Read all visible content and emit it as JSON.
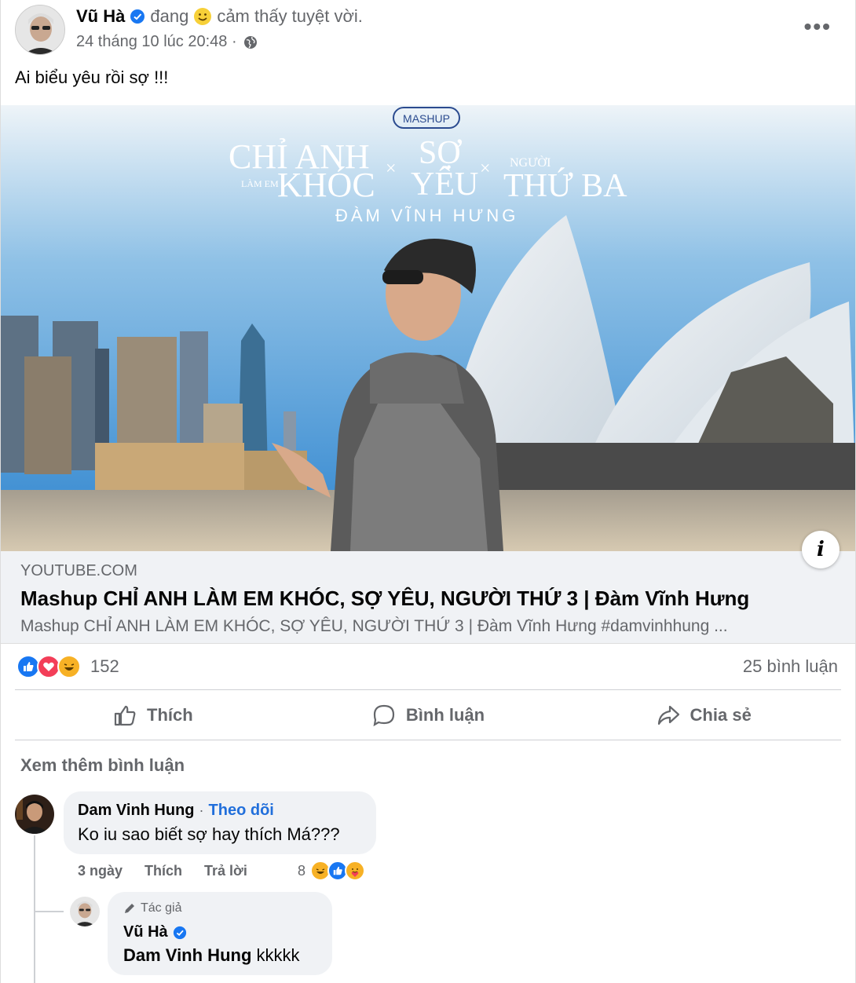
{
  "post": {
    "author": "Vũ Hà",
    "feeling_prefix": "đang",
    "feeling_text": "cảm thấy tuyệt vời.",
    "timestamp": "24 tháng 10 lúc 20:48 ·",
    "more_label": "•••",
    "text": "Ai biểu yêu rồi sợ !!!"
  },
  "media": {
    "badge": "MASHUP",
    "title_part1_big": "CHỈ ANH",
    "title_part1_small": "LÀM EM",
    "title_part1_end": "KHÓC",
    "title_part2_line1": "SỢ",
    "title_part2_line2": "YÊU",
    "title_part3_small": "NGƯỜI",
    "title_part3_big": "THỨ BA",
    "separator": "×",
    "artist": "ĐÀM VĨNH HƯNG"
  },
  "link": {
    "domain": "YOUTUBE.COM",
    "title": "Mashup CHỈ ANH LÀM EM KHÓC, SỢ YÊU, NGƯỜI THỨ 3 | Đàm Vĩnh Hưng",
    "description": "Mashup CHỈ ANH LÀM EM KHÓC, SỢ YÊU, NGƯỜI THỨ 3 | Đàm Vĩnh Hưng #damvinhhung ...",
    "info_label": "i"
  },
  "stats": {
    "reaction_count": "152",
    "comment_count": "25 bình luận"
  },
  "actions": {
    "like": "Thích",
    "comment": "Bình luận",
    "share": "Chia sẻ"
  },
  "comments_section": {
    "see_more": "Xem thêm bình luận",
    "comment1": {
      "name": "Dam Vinh Hung",
      "dot": "·",
      "follow": "Theo dõi",
      "text": "Ko iu sao biết sợ hay thích Má???",
      "time": "3 ngày",
      "like": "Thích",
      "reply": "Trả lời",
      "reaction_count": "8"
    },
    "reply1": {
      "badge": "Tác giả",
      "name": "Vũ Hà",
      "mention": "Dam Vinh Hung",
      "text": " kkkkk"
    }
  },
  "colors": {
    "facebook_blue": "#216fdb",
    "verified_blue": "#1877f2",
    "secondary_text": "#65676b",
    "bubble_bg": "#f0f2f5"
  }
}
